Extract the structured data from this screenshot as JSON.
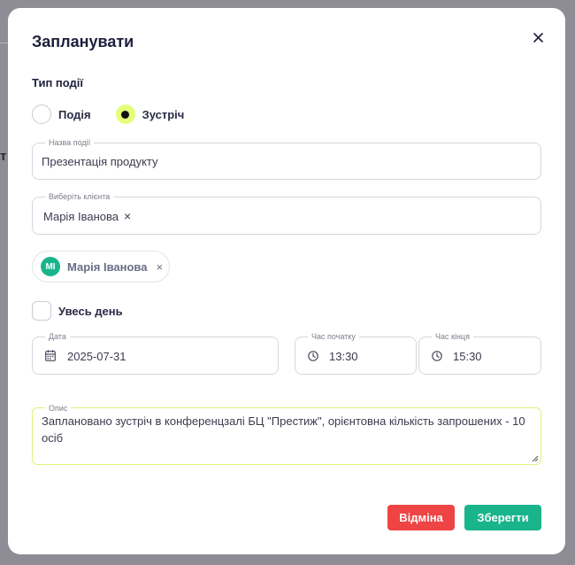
{
  "background": {
    "fragment": "т"
  },
  "modal": {
    "title": "Запланувати",
    "close_icon": "close-icon"
  },
  "event_type": {
    "label": "Тип події",
    "options": [
      {
        "label": "Подія",
        "selected": false
      },
      {
        "label": "Зустріч",
        "selected": true
      }
    ]
  },
  "event_name": {
    "legend": "Назва події",
    "value": "Презентація продукту"
  },
  "client": {
    "legend": "Виберіть клієнта",
    "value": "Марія Іванова"
  },
  "selected_client": {
    "initials": "МІ",
    "name": "Марія Іванова"
  },
  "all_day": {
    "label": "Увесь день",
    "checked": false
  },
  "date": {
    "legend": "Дата",
    "value": "2025-07-31"
  },
  "start_time": {
    "legend": "Час початку",
    "value": "13:30"
  },
  "end_time": {
    "legend": "Час кінця",
    "value": "15:30"
  },
  "description": {
    "legend": "Опис",
    "value": "Заплановано зустріч в конференцзалі БЦ \"Престиж\", орієнтовна кількість запрошених - 10 осіб"
  },
  "actions": {
    "cancel_label": "Відміна",
    "save_label": "Зберегти"
  },
  "colors": {
    "accent": "#e4ff7a",
    "primary": "#19b48c",
    "danger": "#ef4444",
    "title": "#1e1f3b"
  }
}
